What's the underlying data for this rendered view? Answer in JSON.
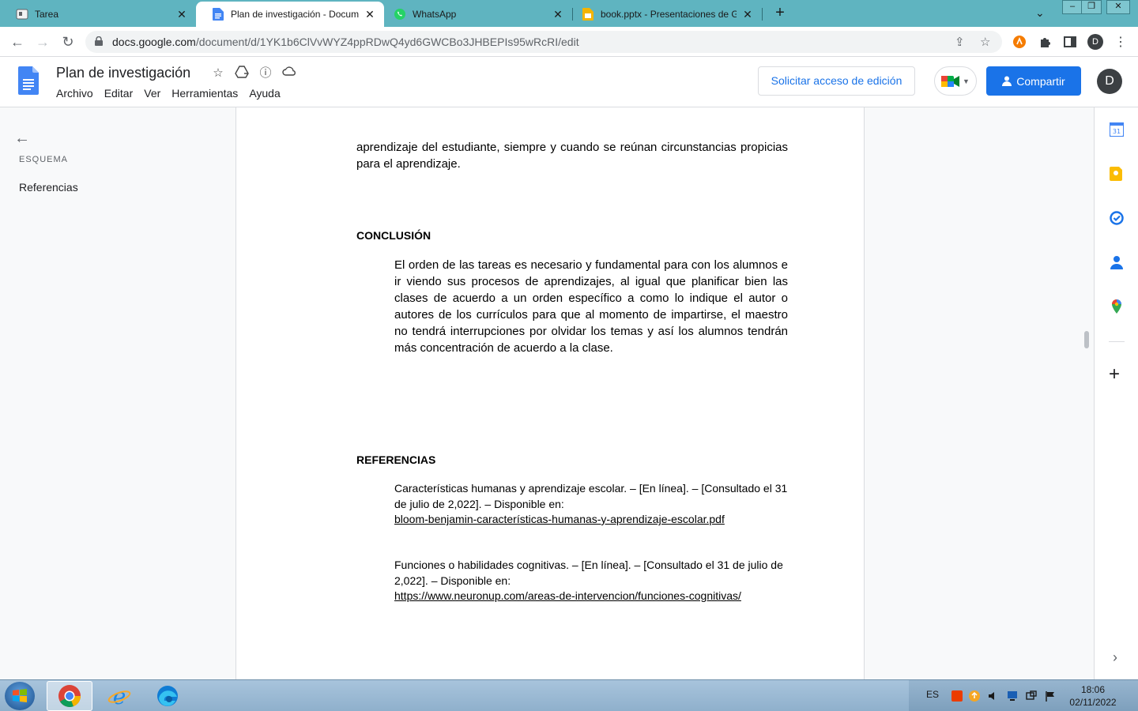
{
  "browser": {
    "tabs": [
      {
        "title": "Tarea",
        "icon": "classroom-icon"
      },
      {
        "title": "Plan de investigación - Documentos",
        "icon": "docs-icon",
        "active": true
      },
      {
        "title": "WhatsApp",
        "icon": "whatsapp-icon"
      },
      {
        "title": "book.pptx - Presentaciones de Google",
        "icon": "slides-icon"
      }
    ],
    "url_host": "docs.google.com",
    "url_path": "/document/d/1YK1b6ClVvWYZ4ppRDwQ4yd6GWCBo3JHBEPIs95wRcRI/edit",
    "profile_initial": "D"
  },
  "docs": {
    "title": "Plan de investigación",
    "menu": [
      "Archivo",
      "Editar",
      "Ver",
      "Herramientas",
      "Ayuda"
    ],
    "request_edit": "Solicitar acceso de edición",
    "share": "Compartir",
    "user_initial": "D",
    "brand_color": "#1a73e8"
  },
  "outline": {
    "label": "ESQUEMA",
    "items": [
      "Referencias"
    ]
  },
  "document": {
    "intro_paragraph": "aprendizaje del estudiante, siempre y cuando se reúnan circunstancias propicias para el aprendizaje.",
    "conclusion_heading": "CONCLUSIÓN",
    "conclusion_text": "El orden de las tareas es necesario y fundamental para con los alumnos e ir viendo sus procesos de aprendizajes, al igual que planificar bien las clases de acuerdo a un orden específico a como lo indique el autor o autores de los currículos para que al momento de impartirse, el maestro no tendrá interrupciones por olvidar los temas y así los alumnos tendrán más concentración de acuerdo a la clase.",
    "references_heading": "REFERENCIAS",
    "references": [
      {
        "text": "Características humanas y aprendizaje escolar. – [En línea]. – [Consultado el 31 de julio de 2,022]. – Disponible en:",
        "link": "bloom-benjamin-características-humanas-y-aprendizaje-escolar.pdf"
      },
      {
        "text": "Funciones o habilidades cognitivas. – [En línea]. – [Consultado el 31 de julio de 2,022]. – Disponible en:",
        "link": "https://www.neuronup.com/areas-de-intervencion/funciones-cognitivas/"
      }
    ]
  },
  "taskbar": {
    "language": "ES",
    "time": "18:06",
    "date": "02/11/2022"
  }
}
